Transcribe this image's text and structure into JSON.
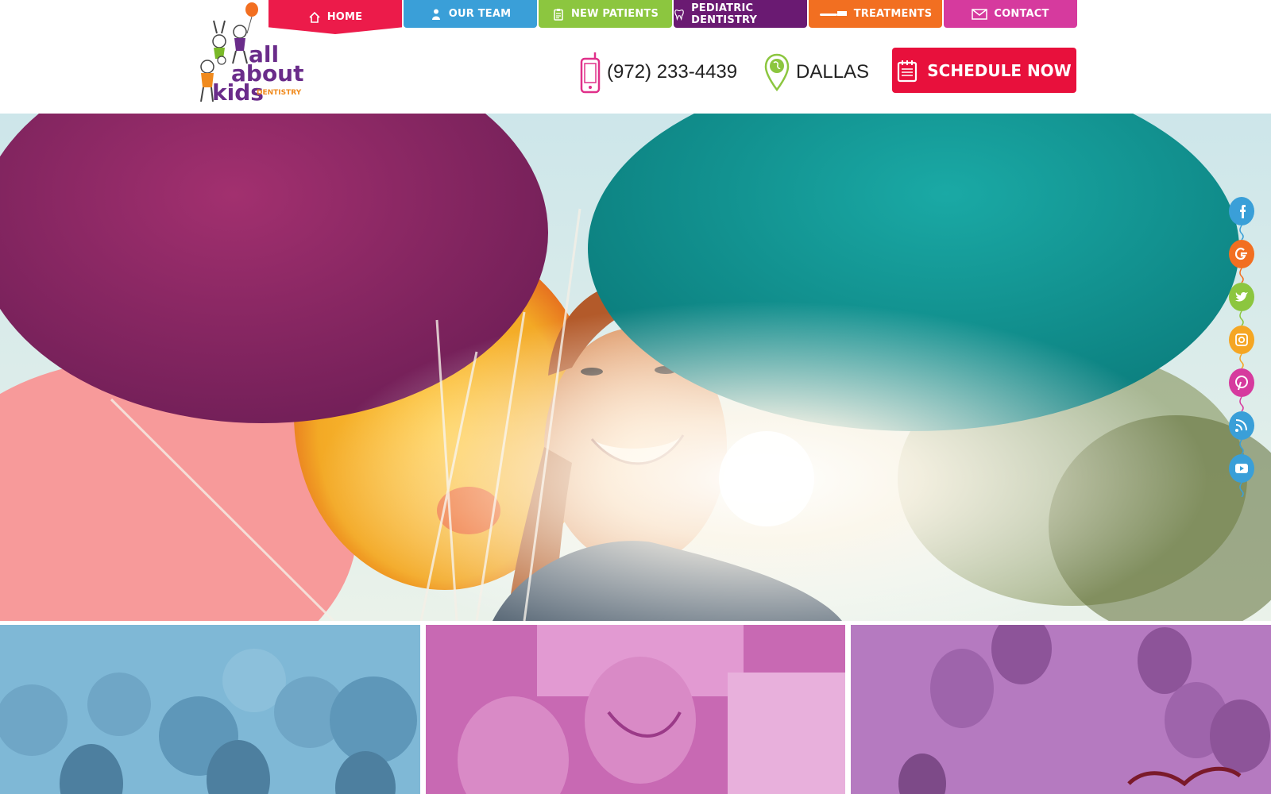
{
  "nav": {
    "items": [
      {
        "label": "HOME",
        "icon": "home-icon",
        "color": "#ec1b4a"
      },
      {
        "label": "OUR TEAM",
        "icon": "person-icon",
        "color": "#3a9fd8"
      },
      {
        "label": "NEW PATIENTS",
        "icon": "clipboard-icon",
        "color": "#8cc63f"
      },
      {
        "label": "PEDIATRIC DENTISTRY",
        "icon": "tooth-icon",
        "color": "#6a1a72"
      },
      {
        "label": "TREATMENTS",
        "icon": "toothbrush-icon",
        "color": "#f26f21"
      },
      {
        "label": "CONTACT",
        "icon": "mail-icon",
        "color": "#d63a9e"
      }
    ],
    "active": "HOME"
  },
  "logo": {
    "line1": "all",
    "line2": "about",
    "line3": "kids",
    "tag": "DENTISTRY",
    "colors": {
      "purple": "#6a2c8a",
      "orange": "#f08a1d",
      "green": "#7ab928"
    }
  },
  "header": {
    "phone": "(972) 233-4439",
    "location": "DALLAS",
    "schedule_label": "SCHEDULE NOW"
  },
  "social": [
    {
      "name": "facebook-icon",
      "color": "#3a9fd8"
    },
    {
      "name": "google-icon",
      "color": "#f26f21"
    },
    {
      "name": "twitter-icon",
      "color": "#8cc63f"
    },
    {
      "name": "instagram-icon",
      "color": "#f5a623"
    },
    {
      "name": "pinterest-icon",
      "color": "#d63a9e"
    },
    {
      "name": "rss-icon",
      "color": "#3a9fd8"
    },
    {
      "name": "youtube-icon",
      "color": "#3a9fd8"
    }
  ],
  "tiles": [
    {
      "name": "tile-blue",
      "tint": "#7fb8d6"
    },
    {
      "name": "tile-pink",
      "tint": "#c869b3"
    },
    {
      "name": "tile-purple",
      "tint": "#b57ac0"
    }
  ]
}
